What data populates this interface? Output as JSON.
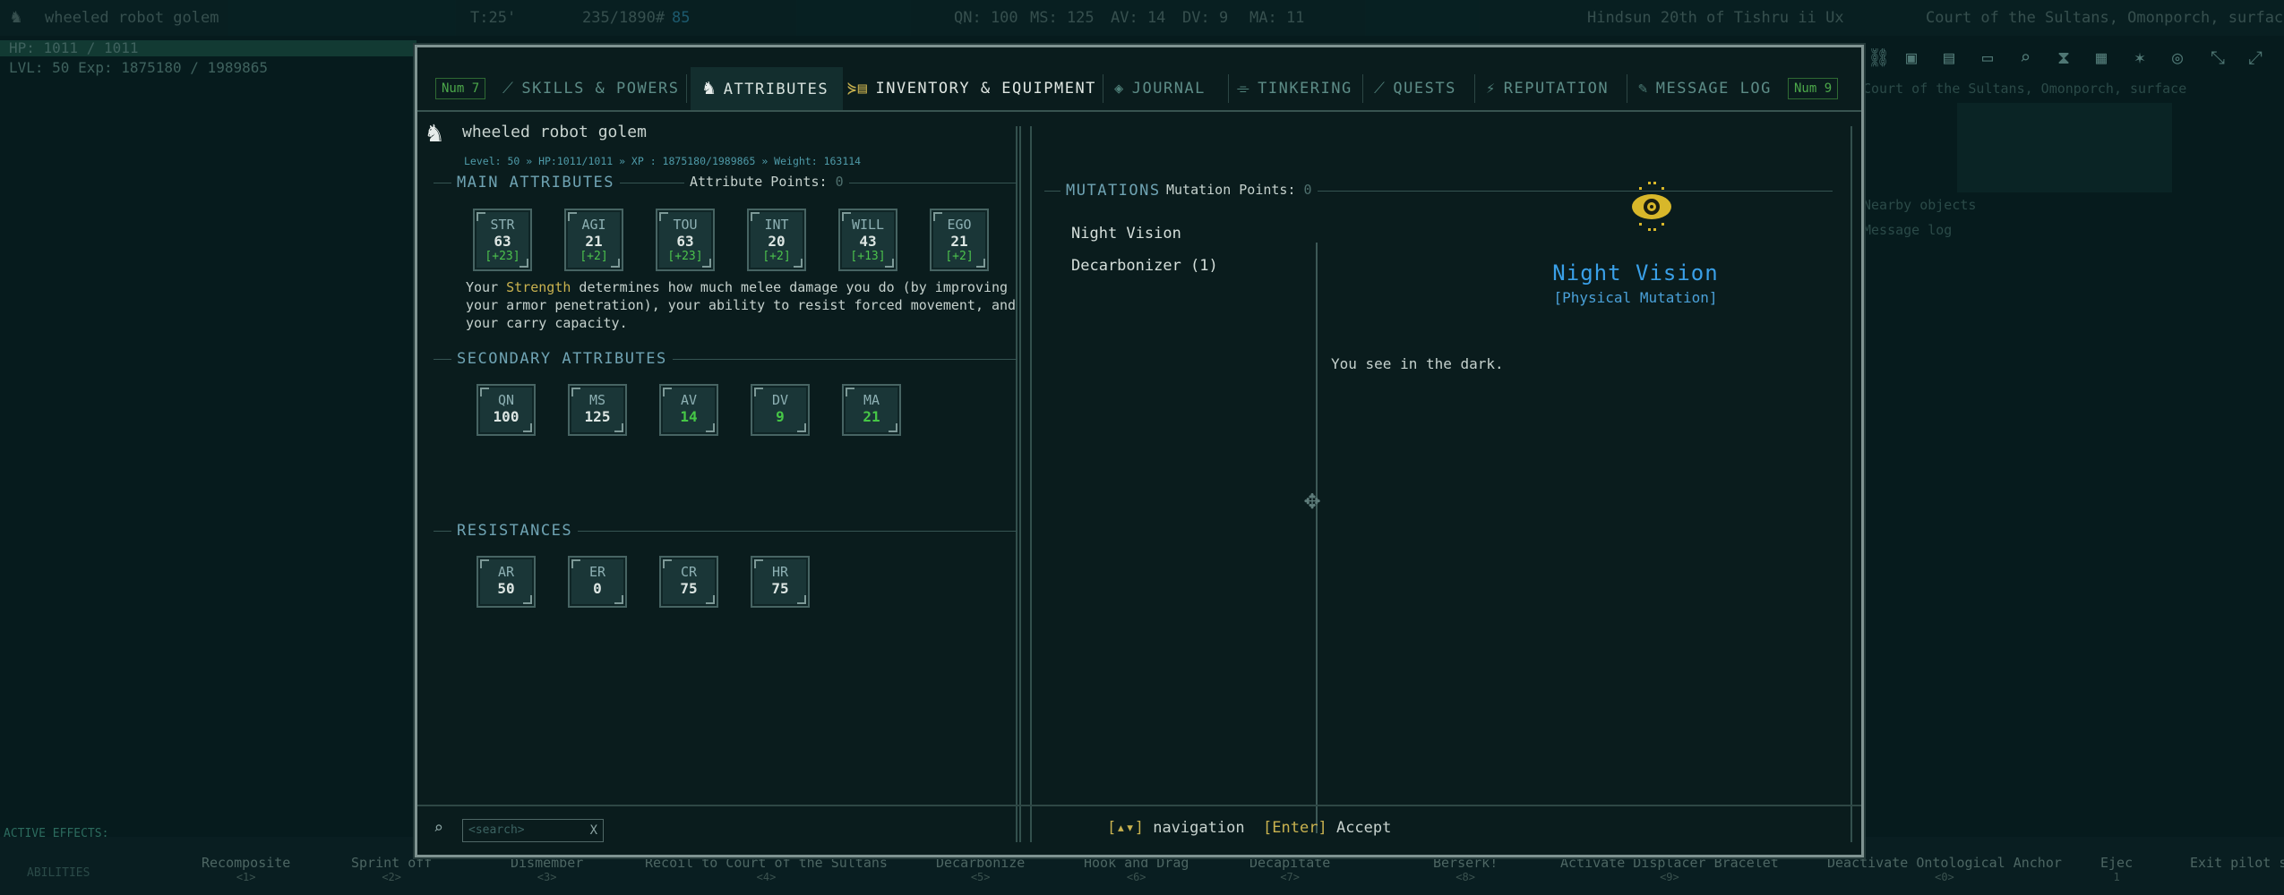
{
  "hud": {
    "player_name": "wheeled robot golem",
    "turn": "T:25'",
    "weight": "235/1890#",
    "money": "85",
    "qn": "QN: 100",
    "ms": "MS: 125",
    "av": "AV: 14",
    "dv": "DV: 9",
    "ma": "MA: 11",
    "date": "Hindsun 20th of Tishru ii Ux",
    "location": "Court of the Sultans, Omonporch, surface",
    "hp": "HP: 1011 / 1011",
    "lvl": "LVL: 50 Exp: 1875180 / 1989865",
    "active_effects": "ACTIVE EFFECTS:",
    "abilities_label": "ABILITIES",
    "side_location": "Court of the Sultans, Omonporch, surface",
    "nearby": "Nearby objects",
    "message_log": "Message log"
  },
  "abilities": [
    {
      "name": "Recomposite",
      "key": "<1>"
    },
    {
      "name": "Sprint  off",
      "key": "<2>"
    },
    {
      "name": "Dismember",
      "key": "<3>"
    },
    {
      "name": "Recoil to Court of the Sultans",
      "key": "<4>"
    },
    {
      "name": "Decarbonize",
      "key": "<5>"
    },
    {
      "name": "Hook and Drag",
      "key": "<6>"
    },
    {
      "name": "Decapitate",
      "key": "<7>"
    },
    {
      "name": "Berserk!",
      "key": "<8>"
    },
    {
      "name": "Activate Displacer Bracelet",
      "key": "<9>"
    },
    {
      "name": "Deactivate Ontological Anchor",
      "key": "<0>"
    },
    {
      "name": "Ejec",
      "key": "1"
    },
    {
      "name": "Exit pilot seat",
      "key": ""
    }
  ],
  "tabs": {
    "num_left": "Num 7",
    "num_right": "Num 9",
    "items": [
      {
        "label": "Skills & Powers"
      },
      {
        "label": "Attributes"
      },
      {
        "label": "Inventory & Equipment"
      },
      {
        "label": "Journal"
      },
      {
        "label": "Tinkering"
      },
      {
        "label": "Quests"
      },
      {
        "label": "Reputation"
      },
      {
        "label": "Message Log"
      }
    ]
  },
  "character": {
    "name": "wheeled robot golem",
    "stats_line": "Level: 50 » HP:1011/1011 » XP : 1875180/1989865 » Weight: 163114"
  },
  "main_attributes": {
    "title": "MAIN ATTRIBUTES",
    "points_label": "Attribute Points:",
    "points_value": "0",
    "items": [
      {
        "label": "STR",
        "value": "63",
        "bonus": "[+23]"
      },
      {
        "label": "AGI",
        "value": "21",
        "bonus": "[+2]"
      },
      {
        "label": "TOU",
        "value": "63",
        "bonus": "[+23]"
      },
      {
        "label": "INT",
        "value": "20",
        "bonus": "[+2]"
      },
      {
        "label": "WILL",
        "value": "43",
        "bonus": "[+13]"
      },
      {
        "label": "EGO",
        "value": "21",
        "bonus": "[+2]"
      }
    ],
    "desc_pre": "Your ",
    "desc_highlight": "Strength",
    "desc_post": " determines how much melee damage you do (by improving your armor penetration), your ability to resist forced movement, and your carry capacity."
  },
  "secondary_attributes": {
    "title": "SECONDARY ATTRIBUTES",
    "items": [
      {
        "label": "QN",
        "value": "100"
      },
      {
        "label": "MS",
        "value": "125"
      },
      {
        "label": "AV",
        "value": "14"
      },
      {
        "label": "DV",
        "value": "9"
      },
      {
        "label": "MA",
        "value": "21"
      }
    ]
  },
  "resistances": {
    "title": "RESISTANCES",
    "items": [
      {
        "label": "AR",
        "value": "50"
      },
      {
        "label": "ER",
        "value": "0"
      },
      {
        "label": "CR",
        "value": "75"
      },
      {
        "label": "HR",
        "value": "75"
      }
    ]
  },
  "mutations": {
    "title": "MUTATIONS",
    "points_label": "Mutation Points:",
    "points_value": "0",
    "items": [
      "Night Vision",
      "Decarbonizer (1)"
    ],
    "selected_name": "Night Vision",
    "selected_type": "[Physical Mutation]",
    "selected_desc": "You see in the dark."
  },
  "footer": {
    "search_placeholder": "<search>",
    "search_clear": "X",
    "nav_key": "[▴▾]",
    "nav_label": "navigation",
    "enter_key": "[Enter]",
    "accept_label": "Accept"
  },
  "colors": {
    "accent_yellow": "#c9b24f",
    "accent_blue": "#3aa0e8",
    "bonus_green": "#4cc24c",
    "panel_bg": "#0a1c1d"
  }
}
